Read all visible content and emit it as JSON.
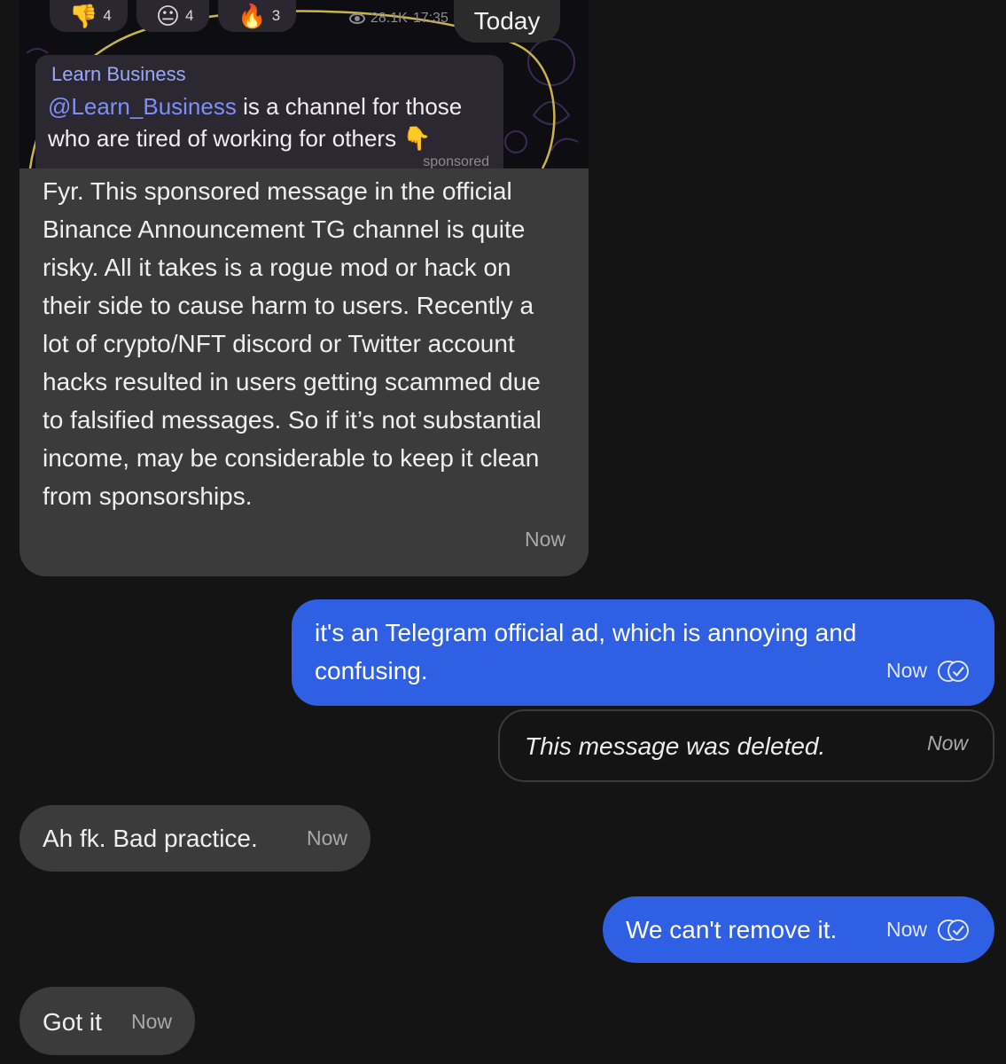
{
  "date_separator": "Today",
  "forwarded_post": {
    "reactions": [
      {
        "icon": "thumbs-down-emoji",
        "glyph": "👎",
        "count": "4"
      },
      {
        "icon": "neutral-face-emoji",
        "glyph": "😐",
        "count": "4"
      },
      {
        "icon": "fire-emoji",
        "glyph": "🔥",
        "count": "3"
      }
    ],
    "views": "28.1K",
    "time": "17:35",
    "ad": {
      "sender": "Learn Business",
      "mention": "@Learn_Business",
      "text_rest": " is a channel for those who are tired of working for others 👇",
      "label": "sponsored"
    }
  },
  "messages": [
    {
      "direction": "incoming",
      "text": "Fyr. This sponsored message in the official Binance Announcement TG channel is quite risky.  All it takes is a rogue mod or hack on their side to cause harm to users. Recently a lot of crypto/NFT discord or Twitter account hacks resulted in users getting scammed due to falsified messages.    So if it’s not substantial income, may be considerable to keep it clean from sponsorships.",
      "time": "Now"
    },
    {
      "direction": "outgoing",
      "text": "it's an Telegram official ad, which is annoying and confusing.",
      "time": "Now",
      "status_icon": "double-check-icon"
    },
    {
      "direction": "outgoing",
      "deleted": true,
      "text": "This message was deleted.",
      "time": "Now"
    },
    {
      "direction": "incoming",
      "text": "Ah fk. Bad practice.",
      "time": "Now"
    },
    {
      "direction": "outgoing",
      "text": "We can't remove it.",
      "time": "Now",
      "status_icon": "double-check-icon"
    },
    {
      "direction": "incoming",
      "text": "Got it",
      "time": "Now"
    }
  ],
  "colors": {
    "background": "#141414",
    "incoming_bubble": "#3b3b3b",
    "outgoing_bubble": "#2f5fe3",
    "mention": "#7f8ff6"
  }
}
